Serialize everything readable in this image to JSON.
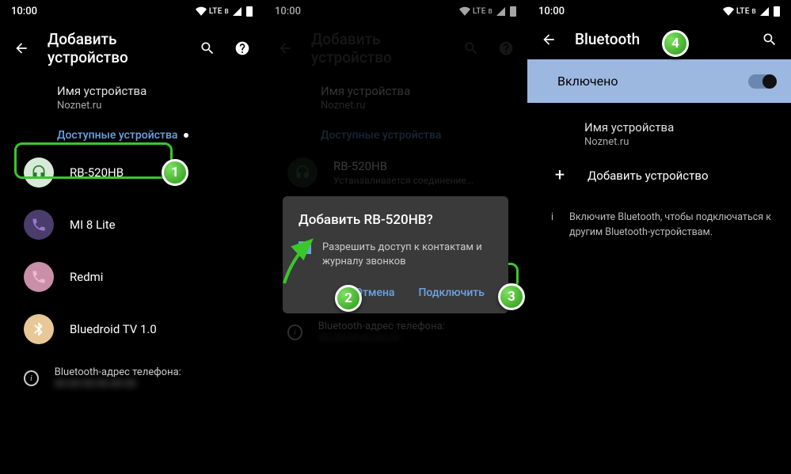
{
  "status": {
    "time": "10:00",
    "net": "LTE",
    "netx": "B"
  },
  "p1": {
    "title": "Добавить устройство",
    "device_name_label": "Имя устройства",
    "device_name_value": "Noznet.ru",
    "avail_label": "Доступные устройства",
    "devices": [
      "RB-520HB",
      "MI 8 Lite",
      "Redmi",
      "Bluedroid TV 1.0"
    ],
    "addr_label": "Bluetooth-адрес телефона:"
  },
  "p2": {
    "title": "Добавить устройство",
    "device_name_label": "Имя устройства",
    "device_name_value": "Noznet.ru",
    "avail_label": "Доступные устройства",
    "dev0": "RB-520HB",
    "dev0_status": "Устанавливается соединение...",
    "addr_label": "Bluetooth-адрес телефона:",
    "dialog": {
      "title": "Добавить RB-520HB?",
      "check_label": "Разрешить доступ к контактам и журналу звонков",
      "cancel": "Отмена",
      "connect": "Подключить"
    }
  },
  "p3": {
    "title": "Bluetooth",
    "enabled": "Включено",
    "device_name_label": "Имя устройства",
    "device_name_value": "Noznet.ru",
    "add": "Добавить устройство",
    "hint": "Включите Bluetooth, чтобы подключаться к другим Bluetooth-устройствам."
  }
}
